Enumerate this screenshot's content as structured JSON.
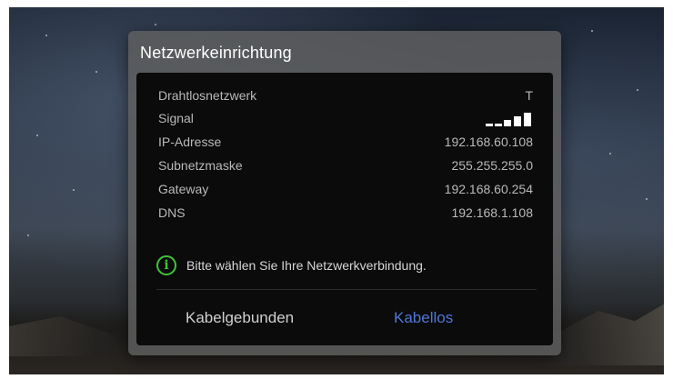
{
  "dialog": {
    "title": "Netzwerkeinrichtung",
    "rows": [
      {
        "label": "Drahtlosnetzwerk",
        "value": "T"
      },
      {
        "label": "Signal",
        "value": ""
      },
      {
        "label": "IP-Adresse",
        "value": "192.168.60.108"
      },
      {
        "label": "Subnetzmaske",
        "value": "255.255.255.0"
      },
      {
        "label": "Gateway",
        "value": "192.168.60.254"
      },
      {
        "label": "DNS",
        "value": "192.168.1.108"
      }
    ],
    "signal_strength": {
      "bars_filled": 5,
      "bars_total": 5
    },
    "notice": {
      "icon": "info-icon",
      "text": "Bitte wählen Sie Ihre Netzwerkverbindung."
    },
    "buttons": {
      "wired": "Kabelgebunden",
      "wireless": "Kabellos"
    }
  },
  "colors": {
    "accent_selected": "#4d77d6",
    "info_icon": "#3fc43a",
    "panel_bg": "#0b0b0b"
  }
}
